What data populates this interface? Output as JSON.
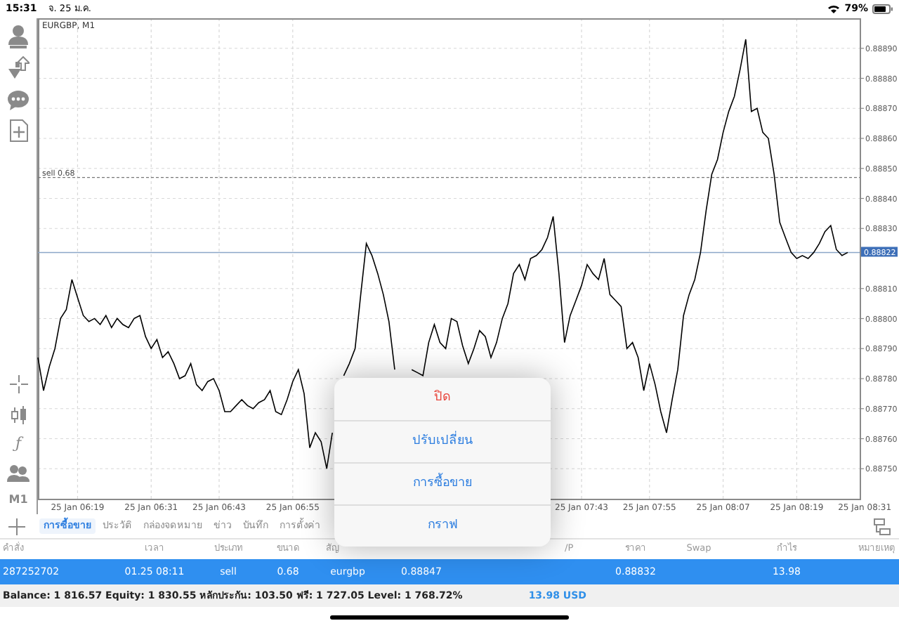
{
  "status_bar": {
    "time": "15:31",
    "date": "จ. 25 ม.ค.",
    "battery": "79%"
  },
  "toolbar": {
    "function_symbol": "ƒ",
    "timeframe": "M1"
  },
  "chart": {
    "chart_data": {
      "type": "line",
      "title": "EURGBP, M1",
      "grid": true,
      "ylim": [
        0.8874,
        0.889
      ],
      "categories": [
        null,
        null,
        null,
        null,
        null,
        null,
        null,
        "25 Jan 06:19",
        null,
        null,
        null,
        null,
        null,
        null,
        null,
        null,
        null,
        null,
        null,
        null,
        "25 Jan 06:31",
        null,
        null,
        null,
        null,
        null,
        null,
        null,
        null,
        null,
        null,
        null,
        "25 Jan 06:43",
        null,
        null,
        null,
        null,
        null,
        null,
        null,
        null,
        null,
        null,
        null,
        null,
        "25 Jan 06:55",
        null,
        null,
        null,
        null,
        null,
        null,
        null,
        null,
        null,
        null,
        null,
        null,
        null,
        null,
        null,
        null,
        null,
        null,
        null,
        null,
        null,
        null,
        null,
        null,
        null,
        null,
        null,
        null,
        null,
        null,
        null,
        null,
        null,
        null,
        null,
        null,
        null,
        null,
        null,
        null,
        null,
        null,
        null,
        null,
        null,
        null,
        null,
        null,
        null,
        null,
        "25 Jan 07:43",
        null,
        null,
        null,
        null,
        null,
        null,
        null,
        null,
        null,
        null,
        null,
        "25 Jan 07:55",
        null,
        null,
        null,
        null,
        null,
        null,
        null,
        null,
        null,
        null,
        null,
        null,
        "25 Jan 08:07",
        null,
        null,
        null,
        null,
        null,
        null,
        null,
        null,
        null,
        null,
        null,
        null,
        "25 Jan 08:19",
        null,
        null,
        null,
        null,
        null,
        null,
        null,
        null,
        null,
        null,
        null,
        "25 Jan 08:31"
      ],
      "series": [
        {
          "color": "#000000",
          "values": [
            0.88787,
            0.88776,
            0.88784,
            0.8879,
            0.888,
            0.88803,
            0.88813,
            0.88807,
            0.88801,
            0.88799,
            0.888,
            0.88798,
            0.88801,
            0.88797,
            0.888,
            0.88798,
            0.88797,
            0.888,
            0.88801,
            0.88794,
            0.8879,
            0.88793,
            0.88787,
            0.88789,
            0.88785,
            0.8878,
            0.88781,
            0.88785,
            0.88778,
            0.88776,
            0.88779,
            0.8878,
            0.88776,
            0.88769,
            0.88769,
            0.88771,
            0.88773,
            0.88771,
            0.8877,
            0.88772,
            0.88773,
            0.88776,
            0.88769,
            0.88768,
            0.88773,
            0.88779,
            0.88783,
            0.88775,
            0.88757,
            0.88762,
            0.88759,
            0.8875,
            0.88762,
            null,
            0.88781,
            0.88785,
            0.8879,
            0.88808,
            0.88825,
            0.88821,
            0.88815,
            0.88808,
            0.88799,
            0.88783,
            null,
            null,
            0.88783,
            0.88782,
            0.88781,
            0.88792,
            0.88798,
            0.88792,
            0.8879,
            0.888,
            0.88799,
            0.88791,
            0.88785,
            0.8879,
            0.88796,
            0.88794,
            0.88787,
            0.88792,
            0.888,
            0.88805,
            0.88815,
            0.88818,
            0.88813,
            0.8882,
            0.88821,
            0.88823,
            0.88827,
            0.88834,
            0.88815,
            0.88792,
            0.88801,
            0.88806,
            0.88811,
            0.88818,
            0.88815,
            0.88813,
            0.8882,
            0.88808,
            0.88806,
            0.88804,
            0.8879,
            0.88792,
            0.88787,
            0.88776,
            0.88785,
            0.88778,
            0.88769,
            0.88762,
            0.88773,
            0.88783,
            0.88801,
            0.88808,
            0.88813,
            0.88822,
            0.88836,
            0.88848,
            0.88853,
            0.88862,
            0.88869,
            0.88874,
            0.88883,
            0.88893,
            0.88869,
            0.8887,
            0.88862,
            0.8886,
            0.88848,
            0.88832,
            0.88827,
            0.88822,
            0.8882,
            0.88821,
            0.8882,
            0.88822,
            0.88825,
            0.88829,
            0.88831,
            0.88823,
            0.88821,
            0.88822,
            null,
            null,
            null
          ]
        }
      ],
      "yticks": [
        {
          "value": 0.8889,
          "label": "0.88890"
        },
        {
          "value": 0.8888,
          "label": "0.88880"
        },
        {
          "value": 0.8887,
          "label": "0.88870"
        },
        {
          "value": 0.8886,
          "label": "0.88860"
        },
        {
          "value": 0.8885,
          "label": "0.88850"
        },
        {
          "value": 0.8884,
          "label": "0.88840"
        },
        {
          "value": 0.8883,
          "label": "0.88830"
        },
        {
          "value": 0.8881,
          "label": "0.88810"
        },
        {
          "value": 0.888,
          "label": "0.88800"
        },
        {
          "value": 0.8879,
          "label": "0.88790"
        },
        {
          "value": 0.8878,
          "label": "0.88780"
        },
        {
          "value": 0.8877,
          "label": "0.88770"
        },
        {
          "value": 0.8876,
          "label": "0.88760"
        },
        {
          "value": 0.8875,
          "label": "0.88750"
        }
      ],
      "ref_lines": [
        {
          "axis": "y",
          "value": 0.88847,
          "label": "sell 0.68"
        },
        {
          "axis": "y",
          "value": 0.88822,
          "label": "0.88822"
        }
      ]
    }
  },
  "tabs": [
    {
      "label": "การซื้อขาย",
      "selected": true
    },
    {
      "label": "ประวัติ",
      "selected": false
    },
    {
      "label": "กล่องจดหมาย",
      "selected": false
    },
    {
      "label": "ข่าว",
      "selected": false
    },
    {
      "label": "บันทึก",
      "selected": false
    },
    {
      "label": "การตั้งค่า",
      "selected": false
    }
  ],
  "table": {
    "columns": [
      {
        "label": "คำสั่ง"
      },
      {
        "label": "เวลา"
      },
      {
        "label": "ประเภท"
      },
      {
        "label": "ขนาด"
      },
      {
        "label": "สัญ"
      },
      {},
      {},
      {
        "label": "/P"
      },
      {
        "label": "ราคา"
      },
      {
        "label": "Swap"
      },
      {
        "label": "กำไร"
      },
      {
        "label": "หมายเหตุ"
      }
    ],
    "rows": [
      {
        "selected": true,
        "cells": [
          "287252702",
          "01.25 08:11",
          "sell",
          "0.68",
          "eurgbp",
          "0.88847",
          "",
          "",
          "0.88832",
          "",
          "13.98",
          ""
        ]
      }
    ]
  },
  "summary": {
    "text": "Balance: 1 816.57 Equity: 1 830.55 หลักประกัน: 103.50 ฟรี: 1 727.05 Level: 1 768.72%",
    "profit": "13.98  USD"
  },
  "menu": {
    "items": [
      {
        "label": "ปิด",
        "kind": "destructive"
      },
      {
        "label": "ปรับเปลี่ยน",
        "kind": "normal"
      },
      {
        "label": "การซื้อขาย",
        "kind": "normal"
      },
      {
        "label": "กราฟ",
        "kind": "normal"
      }
    ]
  }
}
